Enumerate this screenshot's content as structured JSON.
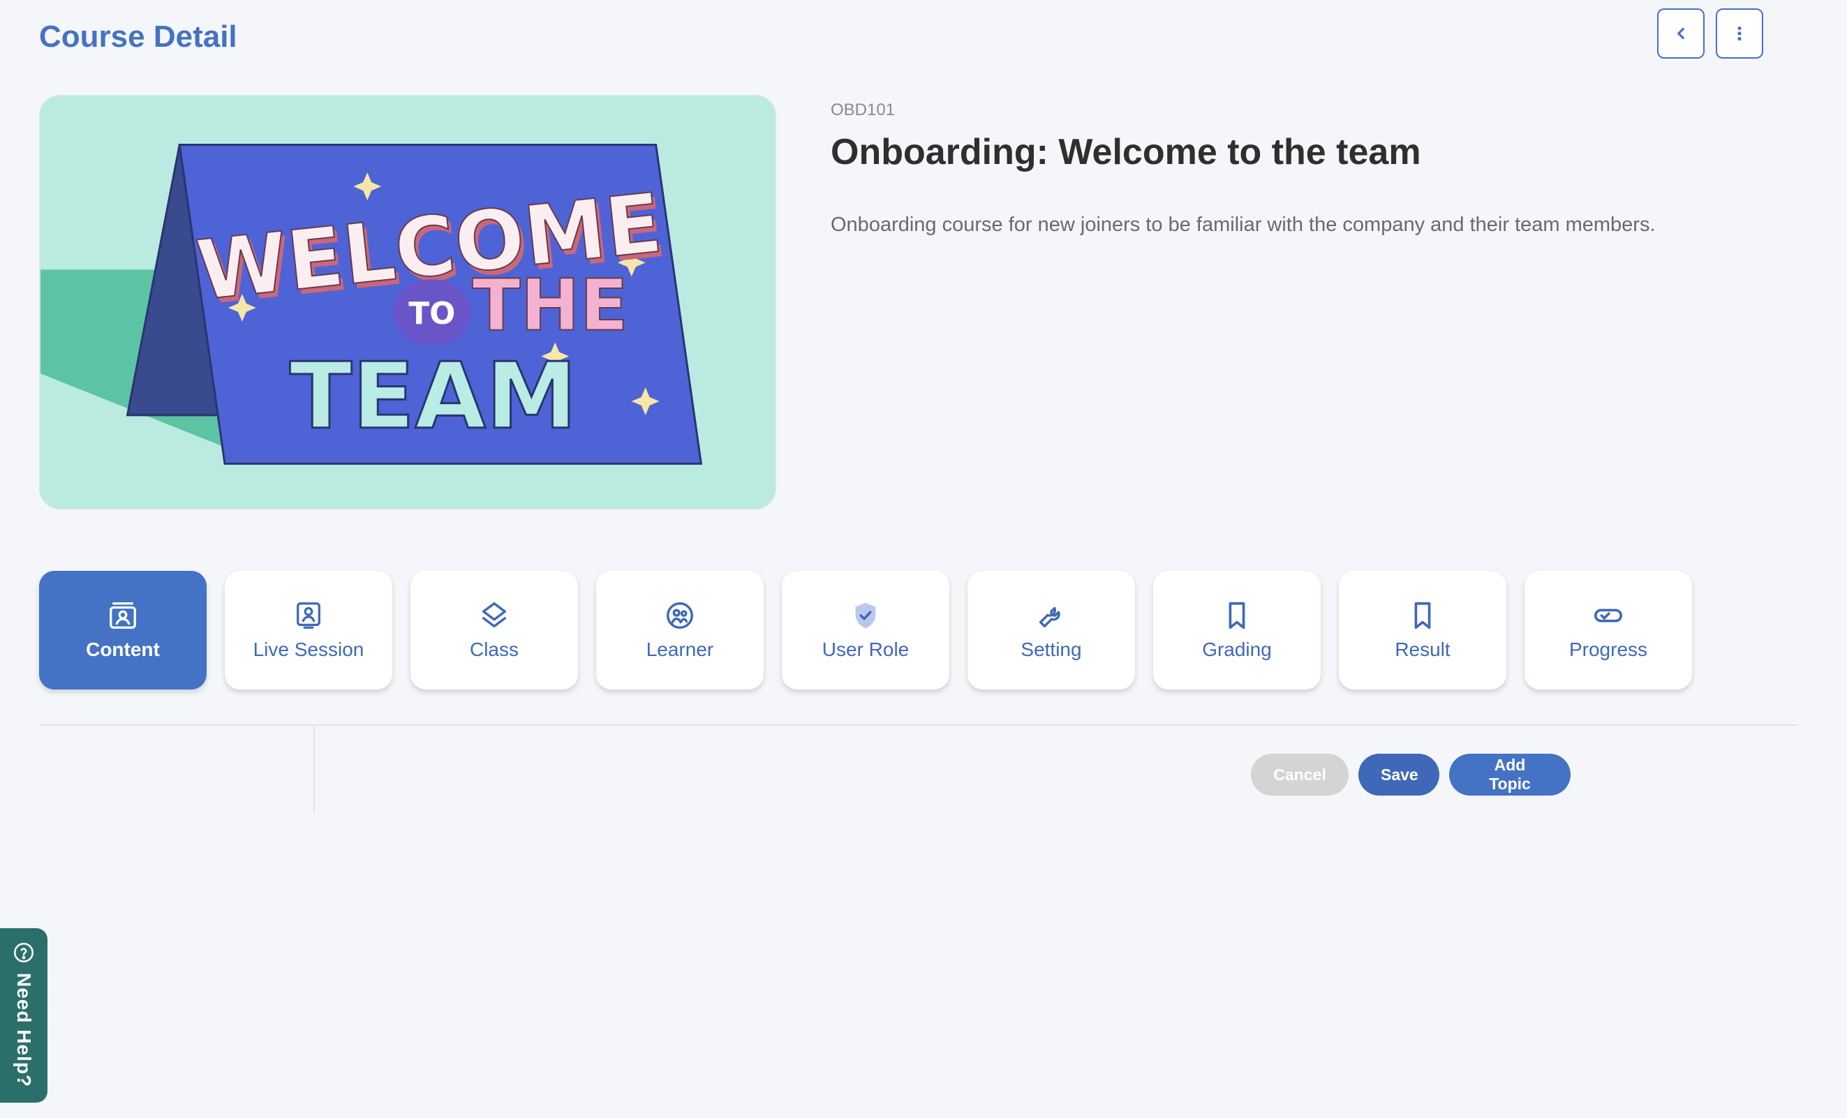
{
  "header": {
    "title": "Course Detail"
  },
  "top_actions": {
    "back_icon": "chevron-left-icon",
    "more_icon": "kebab-vertical-icon"
  },
  "banner": {
    "line1": "WELCOME",
    "line2": "TO",
    "line3": "THE",
    "line4": "TEAM"
  },
  "course": {
    "code": "OBD101",
    "title": "Onboarding: Welcome to the team",
    "description": "Onboarding course for new joiners to be familiar with the company and their team members."
  },
  "tabs": [
    {
      "label": "Content",
      "icon": "content-icon",
      "active": true
    },
    {
      "label": "Live Session",
      "icon": "live-session-icon",
      "active": false
    },
    {
      "label": "Class",
      "icon": "layers-icon",
      "active": false
    },
    {
      "label": "Learner",
      "icon": "learner-icon",
      "active": false
    },
    {
      "label": "User Role",
      "icon": "shield-check-icon",
      "active": false
    },
    {
      "label": "Setting",
      "icon": "wrench-icon",
      "active": false
    },
    {
      "label": "Grading",
      "icon": "bookmark-icon",
      "active": false
    },
    {
      "label": "Result",
      "icon": "bookmark-icon",
      "active": false
    },
    {
      "label": "Progress",
      "icon": "progress-pill-icon",
      "active": false
    }
  ],
  "actions": {
    "cancel": "Cancel",
    "save": "Save",
    "add_topic": "Add Topic"
  },
  "help": {
    "label": "Need Help?"
  },
  "colors": {
    "primary": "#4472c4",
    "background": "#f5f6fa",
    "help": "#2b6f6a",
    "muted": "#d4d4d4"
  }
}
